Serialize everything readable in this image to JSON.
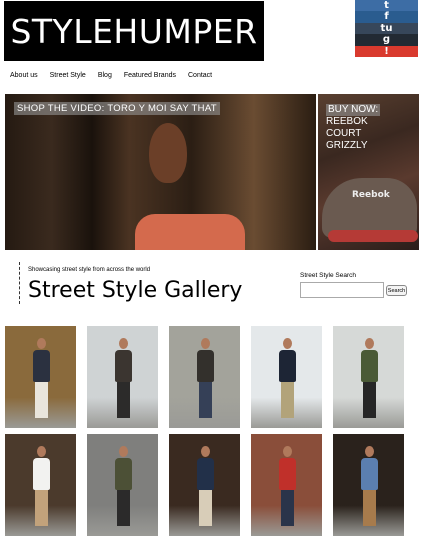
{
  "header": {
    "logo_text": "STYLEHUMPER"
  },
  "social": [
    "t",
    "f",
    "tu",
    "g",
    "!"
  ],
  "nav": {
    "items": [
      "About us",
      "Street Style",
      "Blog",
      "Featured Brands",
      "Contact"
    ]
  },
  "hero": {
    "caption": "SHOP THE VIDEO: TORO Y MOI SAY THAT"
  },
  "promo": {
    "lines": [
      "BUY NOW:",
      "REEBOK",
      "COURT",
      "GRIZZLY"
    ],
    "brand": "Reebok"
  },
  "gallery": {
    "tagline": "Showcasing street style from across the world",
    "title": "Street Style Gallery"
  },
  "search": {
    "label": "Street Style Search",
    "value": "",
    "button": "Search"
  },
  "photos": [
    {
      "bg": "#8a6a3c",
      "top": "#2b3140",
      "legs": "#e9e5dc"
    },
    {
      "bg": "#cfd3d4",
      "top": "#3b3530",
      "legs": "#2c2b2a"
    },
    {
      "bg": "#a3a39b",
      "top": "#33302c",
      "legs": "#354057"
    },
    {
      "bg": "#e4e8ea",
      "top": "#1d2535",
      "legs": "#b2a37a"
    },
    {
      "bg": "#d6d9d7",
      "top": "#4a5a36",
      "legs": "#262626"
    },
    {
      "bg": "#4b3a2c",
      "top": "#f2f2f0",
      "legs": "#c2a27b"
    },
    {
      "bg": "#7f7f7d",
      "top": "#4c5036",
      "legs": "#2b2a2a"
    },
    {
      "bg": "#3a2a20",
      "top": "#223049",
      "legs": "#d8cdb8"
    },
    {
      "bg": "#8a4e3a",
      "top": "#c0302a",
      "legs": "#2a344a"
    },
    {
      "bg": "#2a221c",
      "top": "#5b7fb0",
      "legs": "#a77b4c"
    }
  ]
}
